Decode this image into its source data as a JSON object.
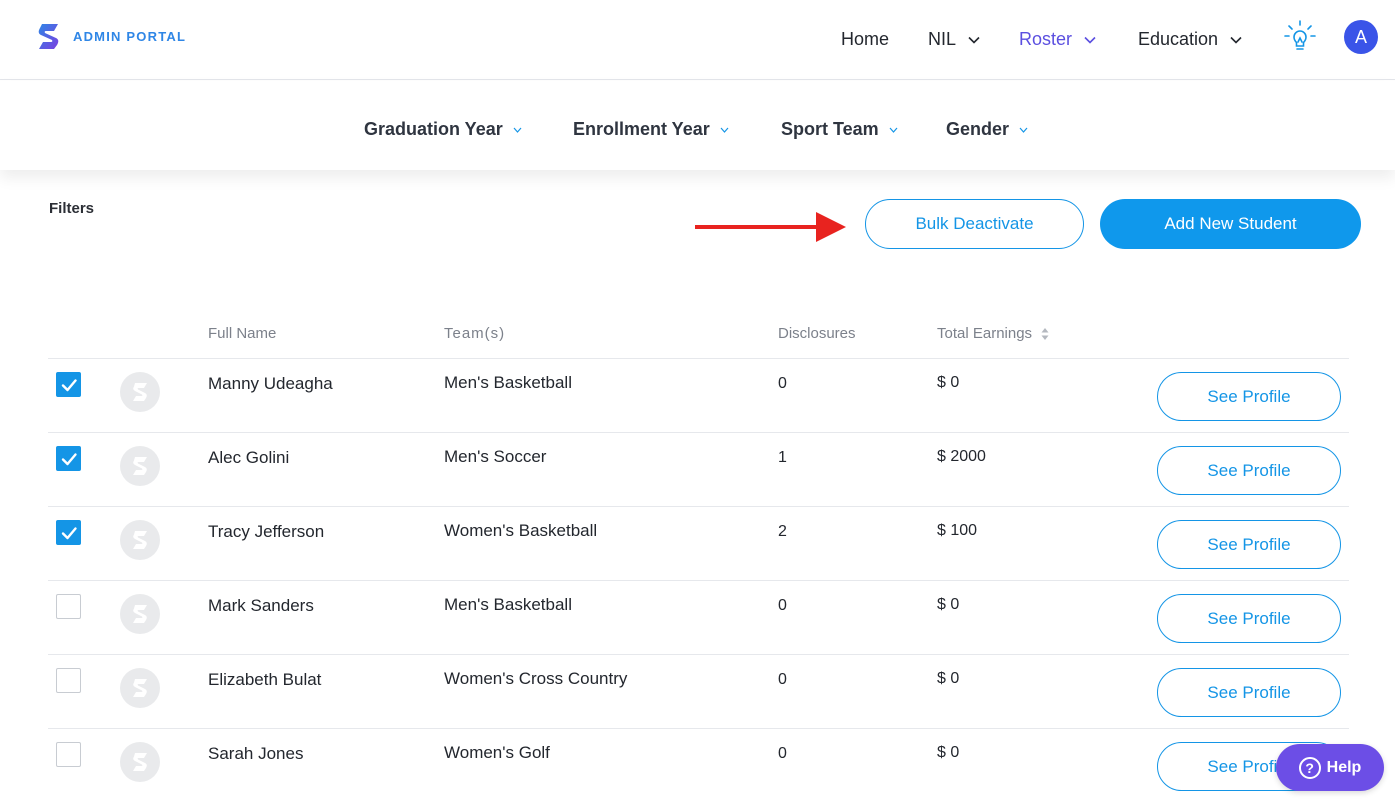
{
  "brand": {
    "name": "ADMIN PORTAL",
    "logo_icon": "brand-s-logo-icon"
  },
  "nav": {
    "items": [
      {
        "label": "Home",
        "has_dropdown": false,
        "active": false
      },
      {
        "label": "NIL",
        "has_dropdown": true,
        "active": false
      },
      {
        "label": "Roster",
        "has_dropdown": true,
        "active": true
      },
      {
        "label": "Education",
        "has_dropdown": true,
        "active": false
      }
    ],
    "tip_icon": "lightbulb-icon",
    "avatar_initial": "A"
  },
  "filter_bar": {
    "items": [
      {
        "label": "Graduation Year"
      },
      {
        "label": "Enrollment Year"
      },
      {
        "label": "Sport Team"
      },
      {
        "label": "Gender"
      }
    ]
  },
  "filters_label": "Filters",
  "actions": {
    "bulk_deactivate": "Bulk Deactivate",
    "add_student": "Add New Student"
  },
  "table": {
    "headers": {
      "name": "Full Name",
      "teams": "Team(s)",
      "disclosures": "Disclosures",
      "earnings": "Total Earnings"
    },
    "rows": [
      {
        "checked": true,
        "name": "Manny Udeagha",
        "team": "Men's Basketball",
        "disclosures": "0",
        "earnings": "$ 0",
        "action": "See Profile"
      },
      {
        "checked": true,
        "name": "Alec Golini",
        "team": "Men's Soccer",
        "disclosures": "1",
        "earnings": "$ 2000",
        "action": "See Profile"
      },
      {
        "checked": true,
        "name": "Tracy Jefferson",
        "team": "Women's Basketball",
        "disclosures": "2",
        "earnings": "$ 100",
        "action": "See Profile"
      },
      {
        "checked": false,
        "name": "Mark Sanders",
        "team": "Men's Basketball",
        "disclosures": "0",
        "earnings": "$ 0",
        "action": "See Profile"
      },
      {
        "checked": false,
        "name": "Elizabeth Bulat",
        "team": "Women's Cross Country",
        "disclosures": "0",
        "earnings": "$ 0",
        "action": "See Profile"
      },
      {
        "checked": false,
        "name": "Sarah Jones",
        "team": "Women's Golf",
        "disclosures": "0",
        "earnings": "$ 0",
        "action": "See Profile"
      }
    ]
  },
  "help": {
    "label": "Help",
    "icon": "question-circle-icon"
  },
  "colors": {
    "primary": "#0f98ec",
    "active_nav": "#5b4fe0",
    "help": "#6c4ee6",
    "annotation_arrow": "#e8231f"
  }
}
